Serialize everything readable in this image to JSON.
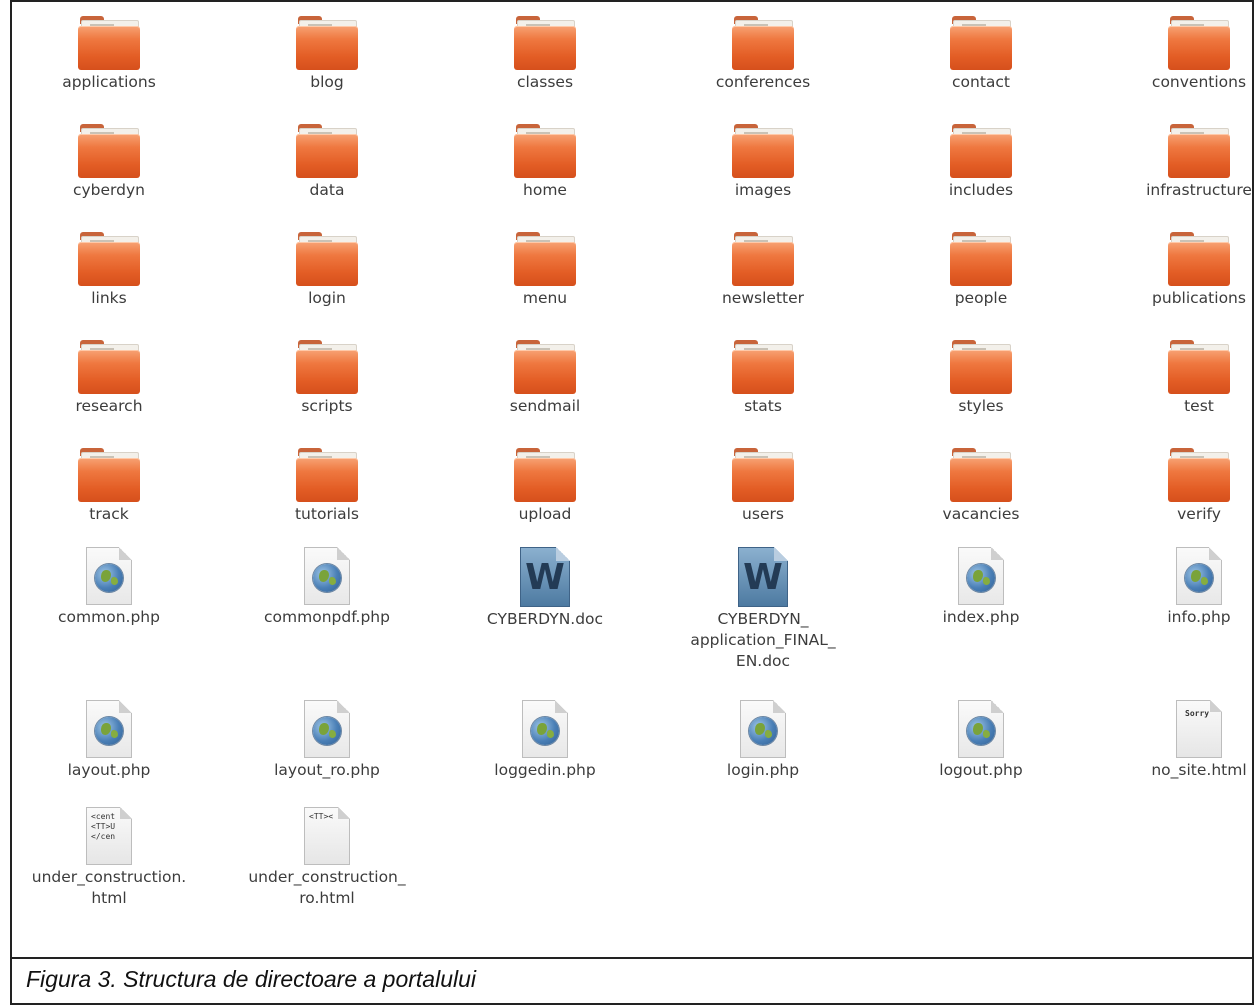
{
  "caption": "Figura 3. Structura de directoare a portalului",
  "folders": [
    "applications",
    "blog",
    "classes",
    "conferences",
    "contact",
    "conventions",
    "cyberdyn",
    "data",
    "home",
    "images",
    "includes",
    "infrastructure",
    "links",
    "login",
    "menu",
    "newsletter",
    "people",
    "publications",
    "research",
    "scripts",
    "sendmail",
    "stats",
    "styles",
    "test",
    "track",
    "tutorials",
    "upload",
    "users",
    "vacancies",
    "verify"
  ],
  "files_row1": [
    {
      "name": "common.php",
      "icon": "php-file-icon"
    },
    {
      "name": "commonpdf.php",
      "icon": "php-file-icon"
    },
    {
      "name": "CYBERDYN.doc",
      "icon": "word-document-icon"
    },
    {
      "name": "CYBERDYN_\napplication_FINAL_\nEN.doc",
      "icon": "word-document-icon"
    },
    {
      "name": "index.php",
      "icon": "php-file-icon"
    },
    {
      "name": "info.php",
      "icon": "php-file-icon"
    }
  ],
  "files_row2": [
    {
      "name": "layout.php",
      "icon": "php-file-icon"
    },
    {
      "name": "layout_ro.php",
      "icon": "php-file-icon"
    },
    {
      "name": "loggedin.php",
      "icon": "php-file-icon"
    },
    {
      "name": "login.php",
      "icon": "php-file-icon"
    },
    {
      "name": "logout.php",
      "icon": "php-file-icon"
    },
    {
      "name": "no_site.html",
      "icon": "html-file-icon",
      "preview": "Sorry"
    }
  ],
  "files_row3": [
    {
      "name": "under_construction.\nhtml",
      "icon": "html-file-icon",
      "preview": "<cent\n<TT>U\n</cen"
    },
    {
      "name": "under_construction_\nro.html",
      "icon": "html-file-icon",
      "preview": "<TT><"
    }
  ]
}
